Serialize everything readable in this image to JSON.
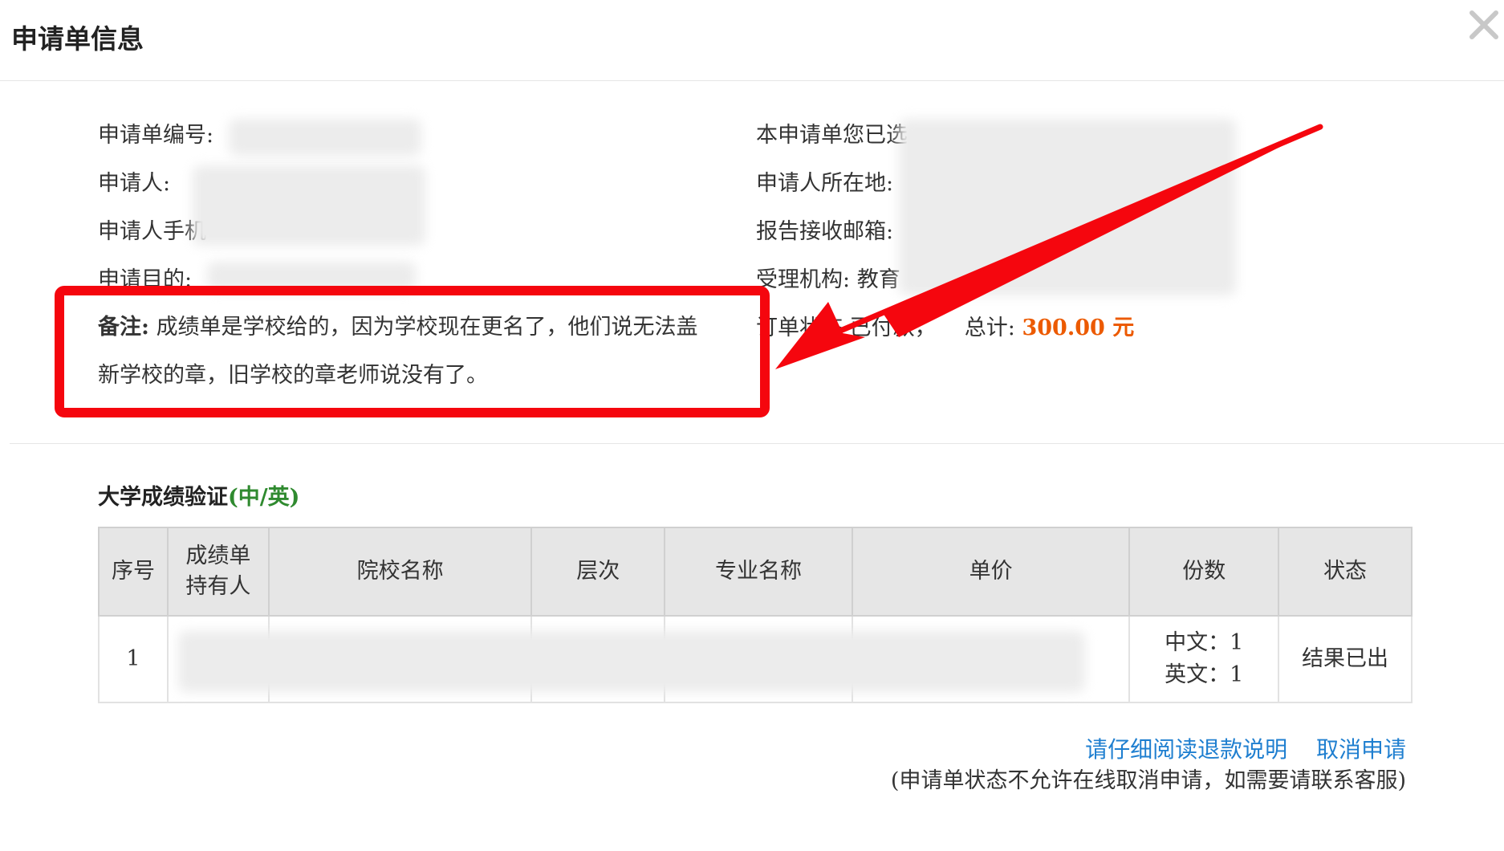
{
  "dialog": {
    "title": "申请单信息",
    "close_icon": "close-icon"
  },
  "info": {
    "left": [
      {
        "label": "申请单编号:",
        "value": ""
      },
      {
        "label": "申请人:",
        "value": ""
      },
      {
        "label": "申请人手机",
        "value": ""
      },
      {
        "label": "申请目的:",
        "value": ""
      }
    ],
    "right": [
      {
        "label": "本申请单您已选",
        "value": ""
      },
      {
        "label": "申请人所在地:",
        "value": ""
      },
      {
        "label": "报告接收邮箱:",
        "value": ""
      },
      {
        "label": "受理机构:",
        "value": "教育"
      }
    ],
    "remark_label": "备注:",
    "remark_line1": "成绩单是学校给的，因为学校现在更名了，他们说无法盖",
    "remark_line2": "新学校的章，旧学校的章老师说没有了。",
    "order_status_label": "订单状态",
    "order_status_value": "已付款，",
    "total_label": "总计:",
    "total_value": "300.00 元"
  },
  "section": {
    "title": "大学成绩验证",
    "subtitle": "(中/英)"
  },
  "table": {
    "headers": [
      "序号",
      "成绩单持有人",
      "院校名称",
      "层次",
      "专业名称",
      "单价",
      "份数",
      "状态"
    ],
    "rows": [
      {
        "index": "1",
        "holder": "",
        "school": "",
        "level": "",
        "major": "",
        "price": "",
        "copies_cn": "中文：1",
        "copies_en": "英文：1",
        "status": "结果已出"
      }
    ]
  },
  "actions": {
    "refund_link": "请仔细阅读退款说明",
    "cancel_link": "取消申请",
    "note": "(申请单状态不允许在线取消申请，如需要请联系客服)"
  },
  "colors": {
    "highlight_red": "#f5060e",
    "total_orange": "#ec5a00",
    "link_blue": "#1f7fd0",
    "subtitle_green": "#2f8a2f"
  }
}
